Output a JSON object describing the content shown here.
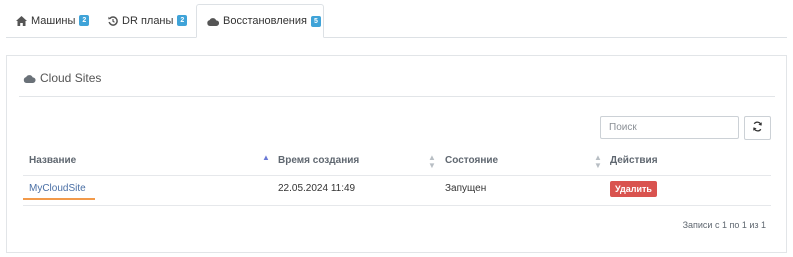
{
  "tabs": [
    {
      "label": "Машины",
      "badge": "2",
      "icon": "home-icon",
      "active": false
    },
    {
      "label": "DR планы",
      "badge": "2",
      "icon": "history-icon",
      "active": false
    },
    {
      "label": "Восстановления",
      "badge": "5",
      "icon": "cloud-icon",
      "active": true
    }
  ],
  "panel": {
    "title": "Cloud Sites",
    "icon": "cloud-icon"
  },
  "search": {
    "placeholder": "Поиск",
    "value": ""
  },
  "refresh": {
    "icon": "refresh-icon"
  },
  "table": {
    "columns": [
      "Название",
      "Время создания",
      "Состояние",
      "Действия"
    ],
    "sorted_column": "Название",
    "rows": [
      {
        "name": "MyCloudSite",
        "created": "22.05.2024 11:49",
        "state": "Запущен",
        "action": "Удалить"
      }
    ]
  },
  "pagination": {
    "info": "Записи с 1 по 1 из 1"
  },
  "colors": {
    "badge": "#3fa3d8",
    "delete": "#d9534f",
    "underline": "#f29a4a"
  }
}
